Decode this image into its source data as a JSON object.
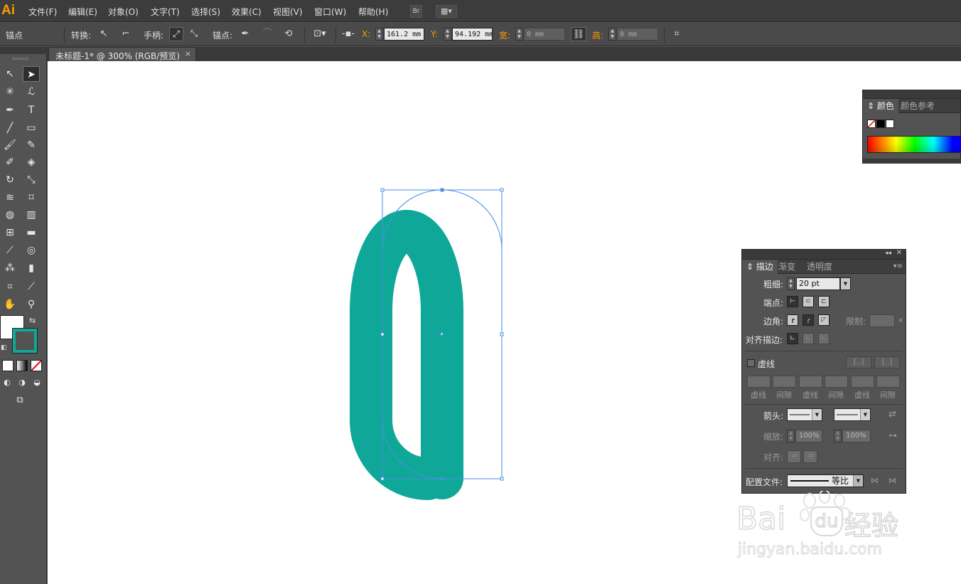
{
  "app": {
    "logo": "Ai",
    "menu": [
      "文件(F)",
      "编辑(E)",
      "对象(O)",
      "文字(T)",
      "选择(S)",
      "效果(C)",
      "视图(V)",
      "窗口(W)",
      "帮助(H)"
    ],
    "bridge_label": "Br"
  },
  "control_bar": {
    "mode_label": "锚点",
    "convert_label": "转换:",
    "handles_label": "手柄:",
    "anchors_label": "锚点:",
    "x_label": "X:",
    "x_value": "161.2 mm",
    "y_label": "Y:",
    "y_value": "94.192 mm",
    "w_label": "宽:",
    "w_value": "0 mm",
    "h_label": "高:",
    "h_value": "0 mm"
  },
  "document": {
    "tab_title": "未标题-1* @ 300% (RGB/预览)",
    "close_glyph": "×"
  },
  "colors": {
    "stroke": "#0fa898",
    "selection": "#4a8fe0",
    "fill": "#ffffff"
  },
  "color_panel": {
    "tabs": [
      "颜色",
      "颜色参考"
    ],
    "active_tab": "颜色"
  },
  "stroke_panel": {
    "tabs": [
      "描边",
      "渐变",
      "透明度"
    ],
    "weight_label": "粗细:",
    "weight_value": "20 pt",
    "cap_label": "端点:",
    "corner_label": "边角:",
    "limit_label": "限制:",
    "limit_suffix": "x",
    "align_label": "对齐描边:",
    "dashed_label": "虚线",
    "dash_labels": [
      "虚线",
      "间隙",
      "虚线",
      "间隙",
      "虚线",
      "间隙"
    ],
    "arrow_label": "箭头:",
    "scale_label": "缩放:",
    "scale_start": "100%",
    "scale_end": "100%",
    "arrow_align_label": "对齐:",
    "profile_label": "配置文件:",
    "profile_value": "等比"
  },
  "watermark": {
    "brand_left": "Bai",
    "brand_mid": "du",
    "brand_cn": "经验",
    "url": "jingyan.baidu.com"
  }
}
